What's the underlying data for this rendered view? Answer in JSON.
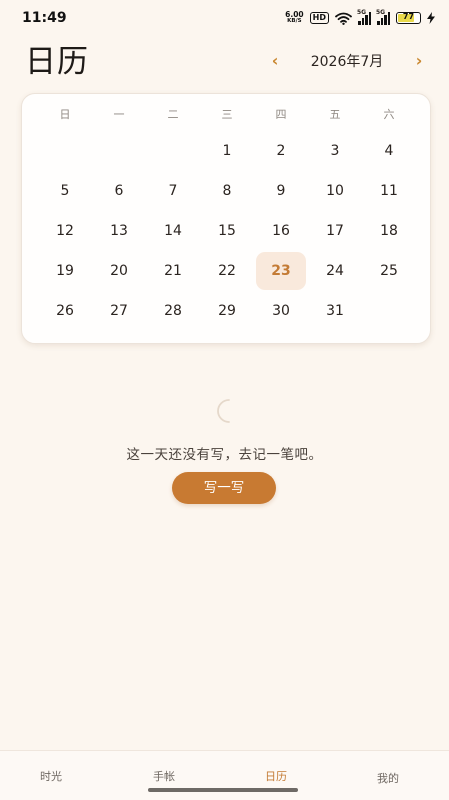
{
  "status_bar": {
    "time": "11:49",
    "net_speed_value": "6.00",
    "net_speed_unit": "KB/S",
    "hd_label": "HD",
    "signal_tag": "5G",
    "battery_level": "77"
  },
  "header": {
    "title": "日历",
    "prev_icon": "‹",
    "next_icon": "›",
    "month_label": "2026年7月"
  },
  "calendar": {
    "weekdays": [
      "日",
      "一",
      "二",
      "三",
      "四",
      "五",
      "六"
    ],
    "days": [
      "",
      "",
      "",
      "1",
      "2",
      "3",
      "4",
      "5",
      "6",
      "7",
      "8",
      "9",
      "10",
      "11",
      "12",
      "13",
      "14",
      "15",
      "16",
      "17",
      "18",
      "19",
      "20",
      "21",
      "22",
      "23",
      "24",
      "25",
      "26",
      "27",
      "28",
      "29",
      "30",
      "31",
      ""
    ],
    "selected_day": "23"
  },
  "empty_state": {
    "icon": "moon-icon",
    "message": "这一天还没有写，去记一笔吧。",
    "button_label": "写一写"
  },
  "bottom_nav": {
    "items": [
      {
        "label": "时光"
      },
      {
        "label": "手帐"
      },
      {
        "label": "日历"
      },
      {
        "label": "我的"
      }
    ],
    "active": "日历"
  },
  "colors": {
    "accent": "#c87a32",
    "background": "#fcf6ef",
    "selected_bg": "#f9e9dc"
  }
}
